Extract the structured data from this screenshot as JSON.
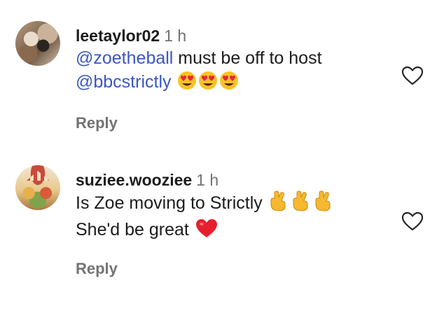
{
  "comments": [
    {
      "username": "leetaylor02",
      "time": "1 h",
      "mention1": "@zoetheball",
      "text1": " must be off to host",
      "mention2": "@bbcstrictly",
      "emoji": "heart-eyes x3",
      "reply_label": "Reply"
    },
    {
      "username": "suziee.wooziee",
      "time": "1 h",
      "line1": "Is Zoe moving to Strictly",
      "line2": "She'd be great",
      "emoji_line1": "crossed-fingers x3",
      "emoji_line2": "red-heart",
      "reply_label": "Reply"
    }
  ],
  "colors": {
    "mention": "#3b57c4",
    "muted": "#737373",
    "text": "#1c1c1c"
  }
}
